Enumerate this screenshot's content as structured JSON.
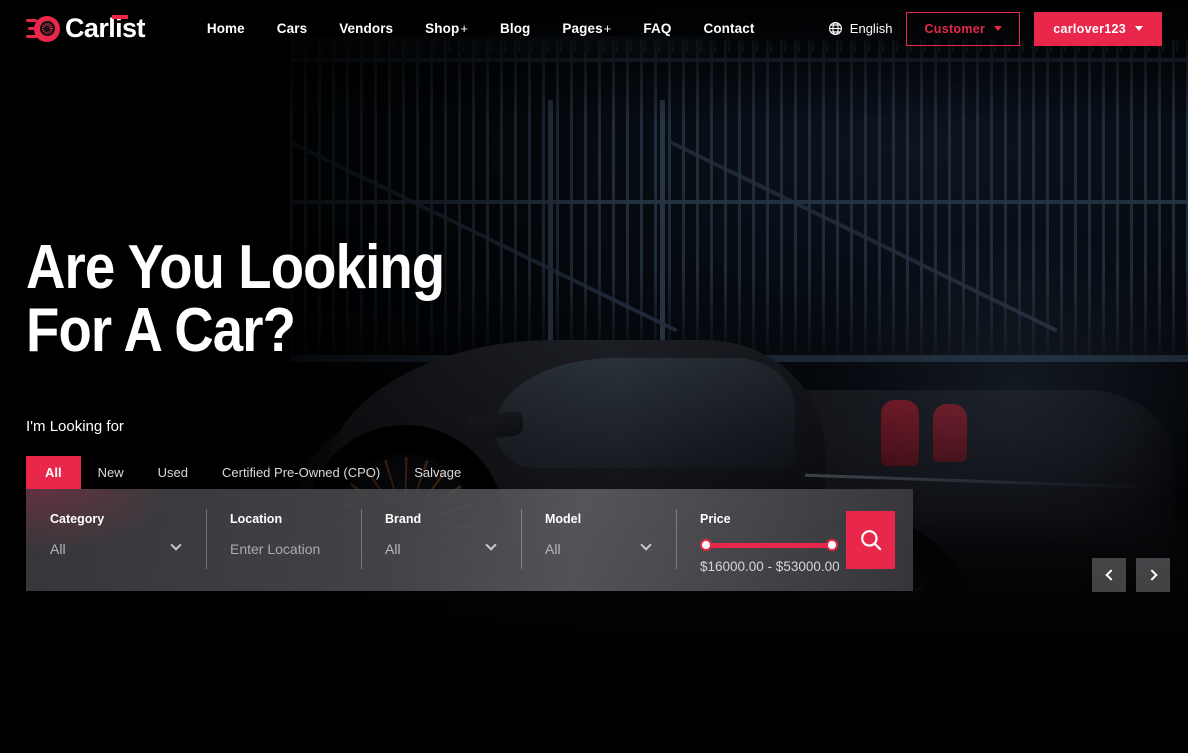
{
  "brand": {
    "name": "Carlist",
    "logo_icon": "tire-speed-icon",
    "accent_color": "#e8274b"
  },
  "header": {
    "nav": [
      {
        "label": "Home",
        "has_dropdown": false
      },
      {
        "label": "Cars",
        "has_dropdown": false
      },
      {
        "label": "Vendors",
        "has_dropdown": false
      },
      {
        "label": "Shop",
        "has_dropdown": true,
        "suffix": "+"
      },
      {
        "label": "Blog",
        "has_dropdown": false
      },
      {
        "label": "Pages",
        "has_dropdown": true,
        "suffix": "+"
      },
      {
        "label": "FAQ",
        "has_dropdown": false
      },
      {
        "label": "Contact",
        "has_dropdown": false
      }
    ],
    "language": {
      "icon": "globe-icon",
      "label": "English"
    },
    "role_button": {
      "label": "Customer",
      "icon": "caret-down-icon"
    },
    "account_button": {
      "label": "carlover123",
      "icon": "caret-down-icon"
    }
  },
  "hero": {
    "title": "Are You Looking For A Car?",
    "looking_for_label": "I'm Looking for",
    "tabs": [
      {
        "label": "All",
        "active": true
      },
      {
        "label": "New",
        "active": false
      },
      {
        "label": "Used",
        "active": false
      },
      {
        "label": "Certified Pre-Owned (CPO)",
        "active": false
      },
      {
        "label": "Salvage",
        "active": false
      }
    ]
  },
  "search": {
    "category": {
      "label": "Category",
      "value": "All",
      "icon": "chevron-down-icon"
    },
    "location": {
      "label": "Location",
      "placeholder": "Enter Location",
      "value": ""
    },
    "brand": {
      "label": "Brand",
      "value": "All",
      "icon": "chevron-down-icon"
    },
    "model": {
      "label": "Model",
      "value": "All",
      "icon": "chevron-down-icon"
    },
    "price": {
      "label": "Price",
      "range_text": "$16000.00 - $53000.00",
      "min": "$16000.00",
      "max": "$53000.00",
      "slider_color": "#e8274b"
    },
    "submit": {
      "icon": "search-icon",
      "label": ""
    }
  },
  "carousel": {
    "prev": {
      "icon": "chevron-left-icon"
    },
    "next": {
      "icon": "chevron-right-icon"
    }
  }
}
